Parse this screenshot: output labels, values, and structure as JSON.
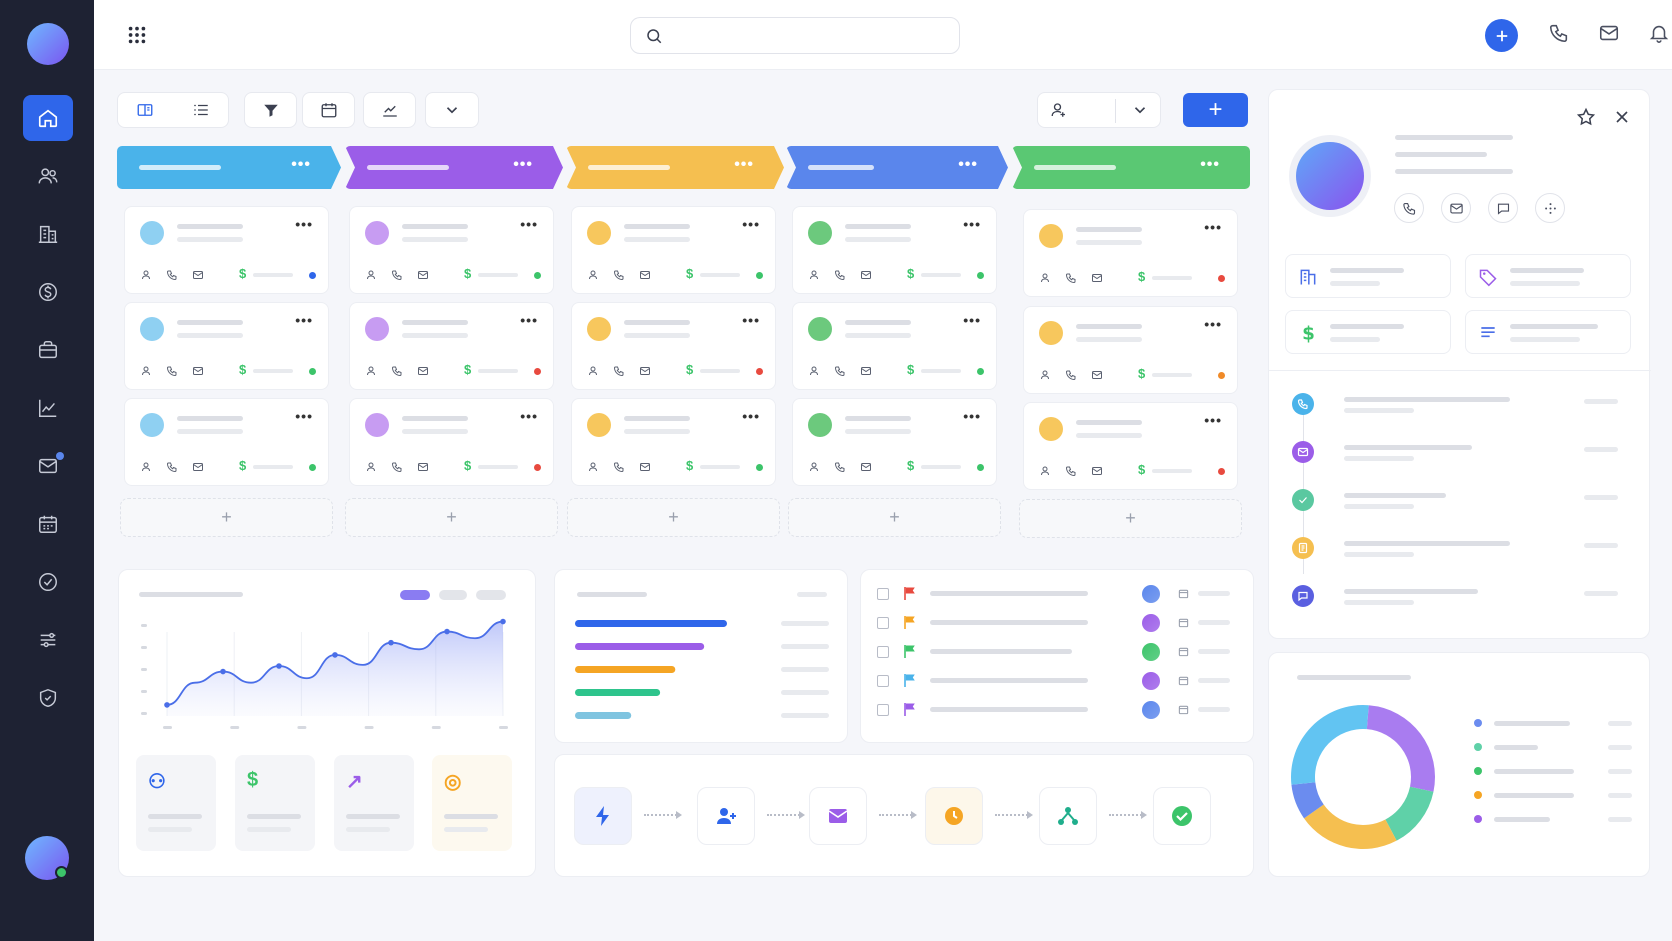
{
  "sidebar": {
    "items": [
      {
        "icon": "home-icon",
        "active": true
      },
      {
        "icon": "users-icon"
      },
      {
        "icon": "building-icon"
      },
      {
        "icon": "dollar-icon"
      },
      {
        "icon": "briefcase-icon"
      },
      {
        "icon": "chart-icon"
      },
      {
        "icon": "mail-icon",
        "badge": true
      },
      {
        "icon": "calendar-icon"
      },
      {
        "icon": "check-circle-icon"
      },
      {
        "icon": "sliders-icon"
      },
      {
        "icon": "shield-icon"
      }
    ]
  },
  "topbar": {
    "search": {
      "placeholder": ""
    },
    "actions": [
      "add-icon",
      "phone-icon",
      "mail-icon",
      "bell-icon",
      "avatar"
    ]
  },
  "toolbar": {
    "view_buttons": [
      "board-view-icon",
      "list-view-icon",
      "filter-icon",
      "calendar-icon",
      "trend-icon",
      "chevron-down-icon"
    ],
    "add_label": "+"
  },
  "pipeline": {
    "stage_colors": [
      "#4ab3ea",
      "#9b5de8",
      "#f5bf50",
      "#5a86ec",
      "#5ac873"
    ],
    "more_label": "•••",
    "add_card_label": "+",
    "columns": [
      {
        "avatar_color": "#8fd0f2",
        "status": [
          "#2f66ea",
          "#3cc46a",
          "#3cc46a"
        ]
      },
      {
        "avatar_color": "#c79cf2",
        "status": [
          "#3cc46a",
          "#e84a3f",
          "#e84a3f"
        ]
      },
      {
        "avatar_color": "#f7c75d",
        "status": [
          "#3cc46a",
          "#e84a3f",
          "#3cc46a"
        ]
      },
      {
        "avatar_color": "#6cc97d",
        "status": [
          "#3cc46a",
          "#3cc46a",
          "#3cc46a"
        ]
      },
      {
        "avatar_color": "#f7c75d",
        "status": [
          "#e84a3f",
          "#f08a28",
          "#e84a3f"
        ]
      }
    ]
  },
  "colors": {
    "accent": "#2f66ea",
    "sidebar_bg": "#1e2233",
    "success": "#3cc46a",
    "danger": "#e84a3f",
    "warning": "#f5a524",
    "purple": "#9b5de8"
  },
  "kpis": [
    {
      "icon": "users-icon",
      "color": "#2f66ea",
      "glyph": "⚇"
    },
    {
      "icon": "dollar-icon",
      "color": "#3cc46a",
      "glyph": "$"
    },
    {
      "icon": "trend-up-icon",
      "color": "#9b5de8",
      "glyph": "↗"
    },
    {
      "icon": "target-icon",
      "color": "#f5a524",
      "glyph": "◎"
    }
  ],
  "tasks": [
    {
      "flag": "#e84a3f",
      "avatar": "#5a86ec"
    },
    {
      "flag": "#f5a524",
      "avatar": "#9b5de8"
    },
    {
      "flag": "#3cc46a",
      "avatar": "#3cc46a"
    },
    {
      "flag": "#4ab3ea",
      "avatar": "#9b5de8"
    },
    {
      "flag": "#9b5de8",
      "avatar": "#5a86ec"
    }
  ],
  "workflow": [
    "bolt-icon",
    "add-user-icon",
    "mail-icon",
    "clock-icon",
    "share-icon",
    "check-icon"
  ],
  "detail": {
    "contact_buttons": [
      "phone-icon",
      "mail-icon",
      "chat-icon",
      "more-icon"
    ],
    "tags": [
      "building-icon",
      "tag-icon",
      "dollar-icon",
      "notes-icon"
    ],
    "timeline": [
      {
        "icon": "phone-icon",
        "color": "#4ab3ea"
      },
      {
        "icon": "mail-icon",
        "color": "#9b5de8"
      },
      {
        "icon": "check-icon",
        "color": "#5ac8a0"
      },
      {
        "icon": "note-icon",
        "color": "#f5bf50"
      },
      {
        "icon": "chat-icon",
        "color": "#5a5fe0"
      }
    ]
  },
  "line_chart": {
    "type": "line",
    "values": [
      1.0,
      3.0,
      4.0,
      3.0,
      4.5,
      3.4,
      5.5,
      4.6,
      6.6,
      6.0,
      7.6,
      7.0,
      8.5
    ]
  },
  "bar_list": {
    "type": "bar",
    "values": [
      100,
      85,
      66,
      56,
      37
    ],
    "colors": [
      "#2f66ea",
      "#9b5de8",
      "#f5a524",
      "#2ec48c",
      "#7fc4e0"
    ]
  },
  "donut": {
    "type": "pie",
    "values": [
      27,
      14,
      23,
      8,
      28
    ],
    "colors": [
      "#a97cf0",
      "#5fd1a8",
      "#f5bf50",
      "#6b8cef",
      "#62c4f2"
    ],
    "legend_colors": [
      "#6b8cef",
      "#5fd1a8",
      "#3cc46a",
      "#f5a524",
      "#9b5de8"
    ]
  }
}
